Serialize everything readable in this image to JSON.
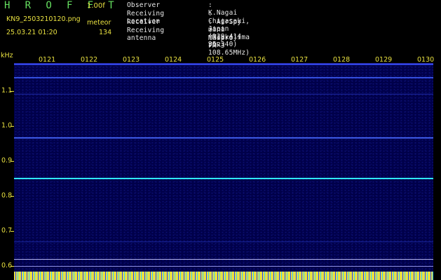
{
  "header": {
    "title": "H R O F F T",
    "version": "1.00f",
    "filename": "KN9_2503210120.png",
    "meteor_label": "meteor",
    "datetime": "25.03.21 01:20",
    "count": "134"
  },
  "info": [
    {
      "label": "Observer",
      "value": ": K.Nagai"
    },
    {
      "label": "Receiving Location",
      "value": ": Chigasaki, Japan (139.414 35.340)"
    },
    {
      "label": "Receiver",
      "value": ": AirSpy mini (Miakejima VOR 108.65MHz)"
    },
    {
      "label": "Receiving antenna",
      "value": ": Maspro FM-3"
    }
  ],
  "axis": {
    "y_unit": "kHz",
    "y_ticks": [
      "1.1",
      "1.0",
      "0.9",
      "0.8",
      "0.7",
      "0.6"
    ],
    "x_ticks": [
      "0121",
      "0122",
      "0123",
      "0124",
      "0125",
      "0126",
      "0127",
      "0128",
      "0129",
      "0130"
    ]
  },
  "colors": {
    "label_yellow": "#e8e040",
    "title_green": "#66e060",
    "background": "#00004a",
    "carrier_cyan": "#30e8ff"
  }
}
